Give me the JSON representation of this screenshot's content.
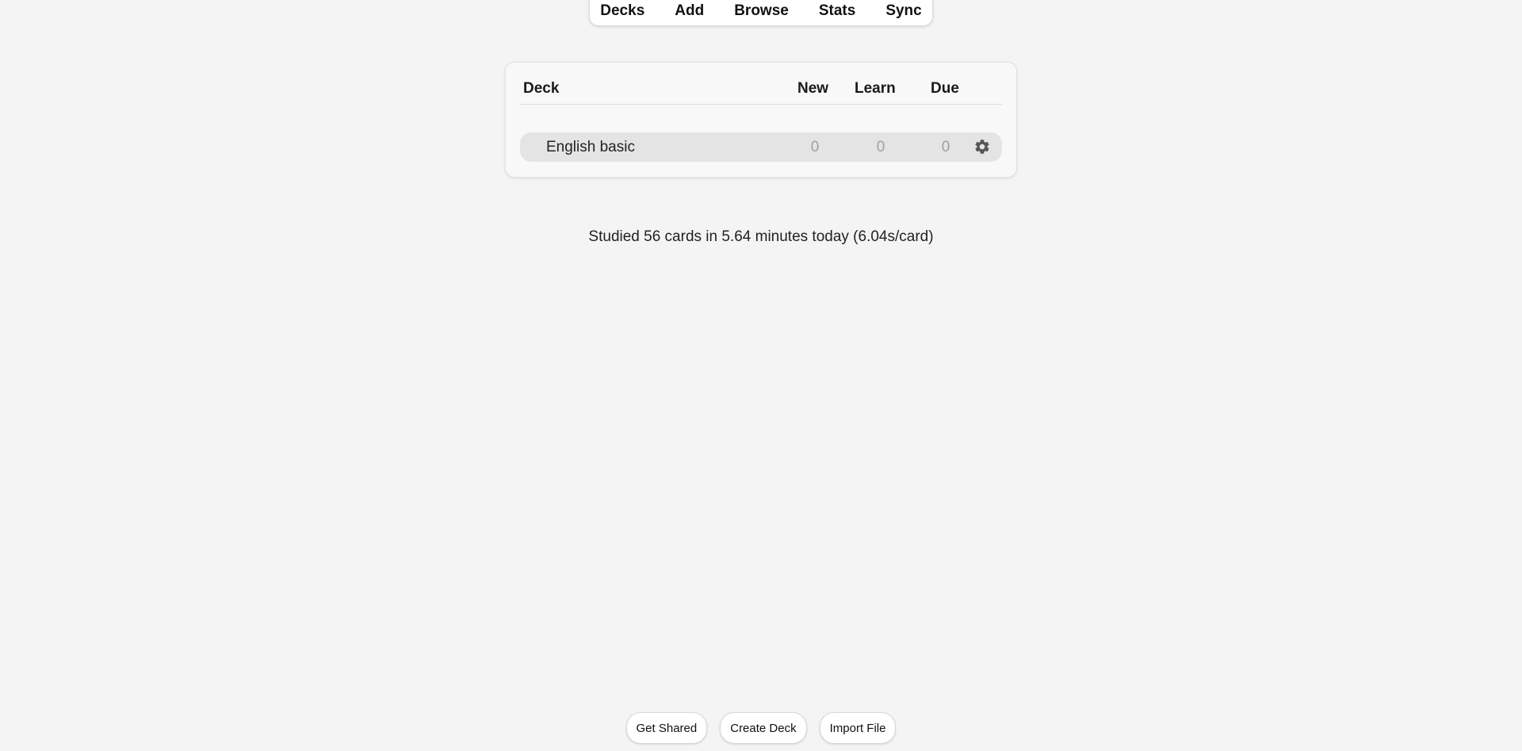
{
  "toolbar": {
    "items": [
      "Decks",
      "Add",
      "Browse",
      "Stats",
      "Sync"
    ]
  },
  "deck_table": {
    "headers": {
      "deck": "Deck",
      "new": "New",
      "learn": "Learn",
      "due": "Due"
    },
    "rows": [
      {
        "name": "English basic",
        "new": "0",
        "learn": "0",
        "due": "0",
        "options_icon": "gear-icon"
      }
    ]
  },
  "studied_text": "Studied 56 cards in 5.64 minutes today (6.04s/card)",
  "bottom_buttons": {
    "get_shared": "Get Shared",
    "create_deck": "Create Deck",
    "import_file": "Import File"
  },
  "colors": {
    "background": "#f4f4f4",
    "row_background": "#e4e4e4",
    "count_zero": "#a0a0a0"
  }
}
